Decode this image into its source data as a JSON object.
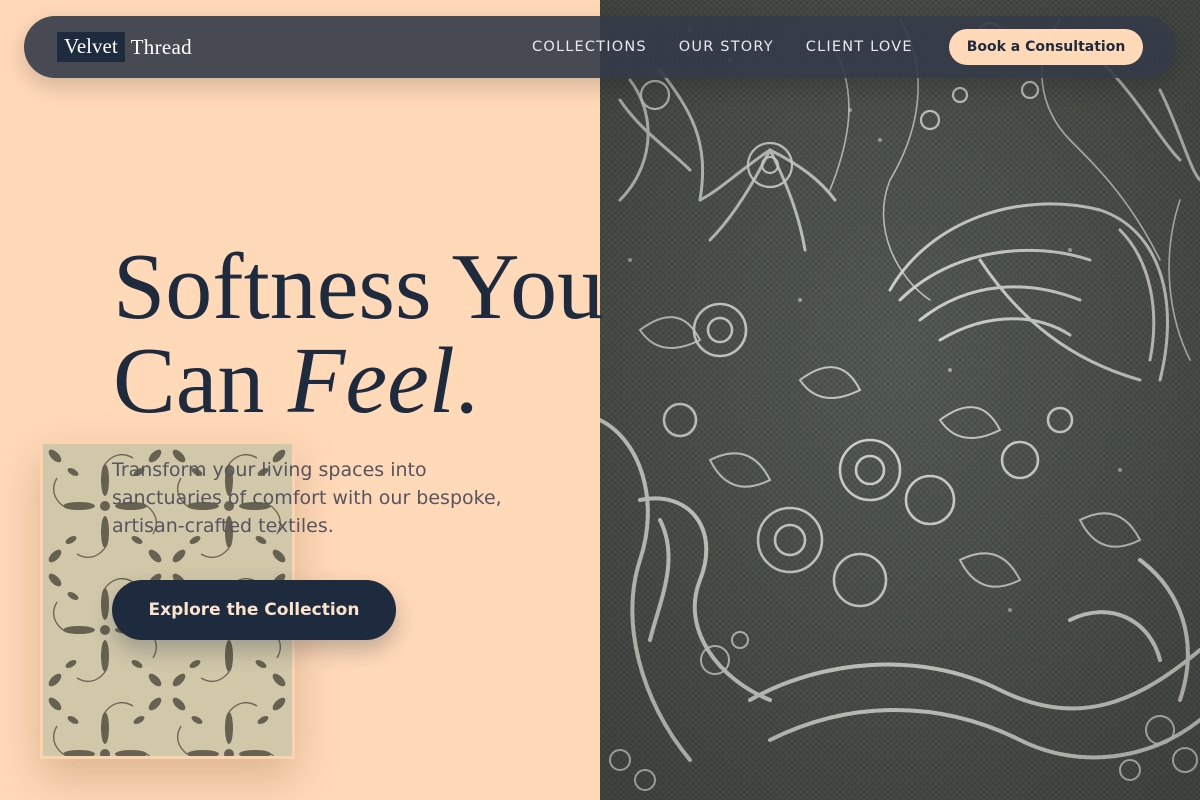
{
  "brand": {
    "logo_first": "Velvet",
    "logo_second": "Thread"
  },
  "nav": {
    "links": [
      {
        "label": "COLLECTIONS"
      },
      {
        "label": "OUR STORY"
      },
      {
        "label": "CLIENT LOVE"
      }
    ],
    "cta_label": "Book a Consultation"
  },
  "hero": {
    "title_line1": "Softness You",
    "title_line2_plain": "Can ",
    "title_line2_italic": "Feel",
    "title_line2_end": ".",
    "subtitle": "Transform your living spaces into sanctuaries of comfort with our bespoke, artisan-crafted textiles.",
    "cta_label": "Explore the Collection"
  },
  "images": {
    "hero_image": "lace-fabric-photo",
    "card_image": "batik-fabric-photo"
  },
  "colors": {
    "background": "#ffd9b8",
    "navy": "#1e2a3e",
    "navbar": "#343a48",
    "lace_dark": "#4f554f",
    "lace_light": "#dfe3dc"
  }
}
